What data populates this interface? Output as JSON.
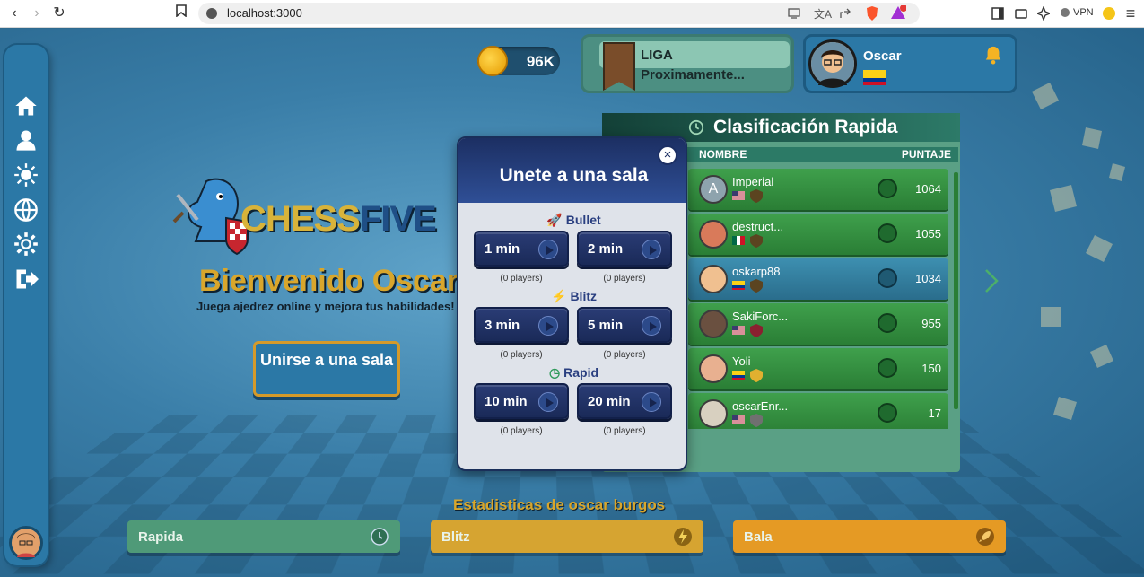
{
  "browser": {
    "url": "localhost:3000",
    "vpn_label": "VPN",
    "notif_count": "1"
  },
  "header": {
    "coins": "96K",
    "league_title": "LIGA",
    "league_status": "Proximamente...",
    "username": "Oscar"
  },
  "hero": {
    "logo_part1": "CHESS",
    "logo_part2": "FIVE",
    "welcome": "Bienvenido Oscar",
    "tagline": "Juega ajedrez online y mejora tus habilidades!",
    "join_label": "Unirse a una sala"
  },
  "ranking": {
    "title": "Clasificación Rapida",
    "col_name": "NOMBRE",
    "col_score": "PUNTAJE",
    "rows": [
      {
        "initial": "A",
        "name": "Imperial",
        "score": "1064"
      },
      {
        "initial": "",
        "name": "destruct...",
        "score": "1055"
      },
      {
        "initial": "",
        "name": "oskarp88",
        "score": "1034"
      },
      {
        "initial": "",
        "name": "SakiForc...",
        "score": "955"
      },
      {
        "initial": "",
        "name": "Yoli",
        "score": "150"
      },
      {
        "initial": "",
        "name": "oscarEnr...",
        "score": "17"
      }
    ]
  },
  "stats": {
    "title": "Estadisticas de oscar burgos",
    "rapid": "Rapida",
    "blitz": "Blitz",
    "bullet": "Bala"
  },
  "modal": {
    "title": "Unete a una sala",
    "close": "×",
    "categories": [
      {
        "name": "Bullet",
        "icon": "🚀",
        "options": [
          {
            "label": "1 min",
            "players": "(0 players)"
          },
          {
            "label": "2 min",
            "players": "(0 players)"
          }
        ]
      },
      {
        "name": "Blitz",
        "icon": "⚡",
        "options": [
          {
            "label": "3 min",
            "players": "(0 players)"
          },
          {
            "label": "5 min",
            "players": "(0 players)"
          }
        ]
      },
      {
        "name": "Rapid",
        "icon": "◷",
        "options": [
          {
            "label": "10 min",
            "players": "(0 players)"
          },
          {
            "label": "20 min",
            "players": "(0 players)"
          }
        ]
      }
    ]
  },
  "colors": {
    "sidebar": "#2b78a6",
    "gold": "#d8a62c",
    "modal_header": "#1c2f63",
    "rank_green": "#3fa04c",
    "stat_rapid": "#4f9a78",
    "stat_blitz": "#d6a431",
    "stat_bullet": "#e59a24"
  }
}
